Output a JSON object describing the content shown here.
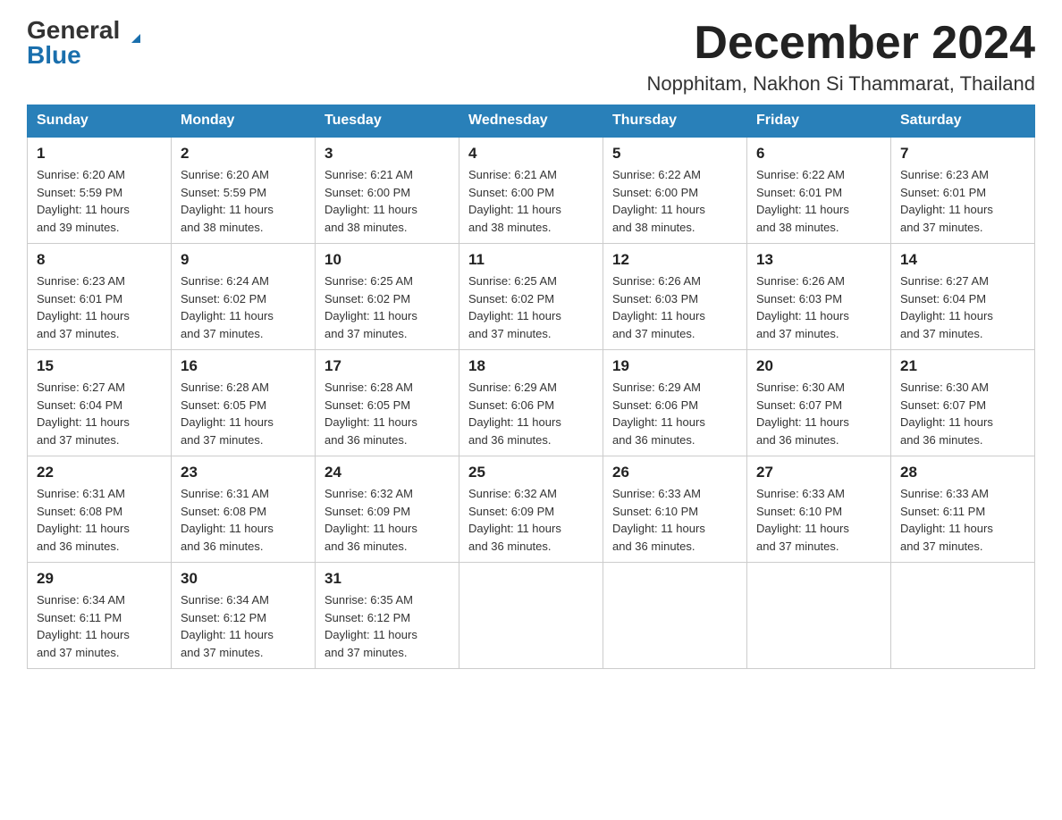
{
  "logo": {
    "general": "General",
    "blue": "Blue",
    "triangle": "▲"
  },
  "title": {
    "month_year": "December 2024",
    "location": "Nopphitam, Nakhon Si Thammarat, Thailand"
  },
  "headers": [
    "Sunday",
    "Monday",
    "Tuesday",
    "Wednesday",
    "Thursday",
    "Friday",
    "Saturday"
  ],
  "weeks": [
    [
      {
        "num": "1",
        "sunrise": "6:20 AM",
        "sunset": "5:59 PM",
        "daylight": "11 hours and 39 minutes."
      },
      {
        "num": "2",
        "sunrise": "6:20 AM",
        "sunset": "5:59 PM",
        "daylight": "11 hours and 38 minutes."
      },
      {
        "num": "3",
        "sunrise": "6:21 AM",
        "sunset": "6:00 PM",
        "daylight": "11 hours and 38 minutes."
      },
      {
        "num": "4",
        "sunrise": "6:21 AM",
        "sunset": "6:00 PM",
        "daylight": "11 hours and 38 minutes."
      },
      {
        "num": "5",
        "sunrise": "6:22 AM",
        "sunset": "6:00 PM",
        "daylight": "11 hours and 38 minutes."
      },
      {
        "num": "6",
        "sunrise": "6:22 AM",
        "sunset": "6:01 PM",
        "daylight": "11 hours and 38 minutes."
      },
      {
        "num": "7",
        "sunrise": "6:23 AM",
        "sunset": "6:01 PM",
        "daylight": "11 hours and 37 minutes."
      }
    ],
    [
      {
        "num": "8",
        "sunrise": "6:23 AM",
        "sunset": "6:01 PM",
        "daylight": "11 hours and 37 minutes."
      },
      {
        "num": "9",
        "sunrise": "6:24 AM",
        "sunset": "6:02 PM",
        "daylight": "11 hours and 37 minutes."
      },
      {
        "num": "10",
        "sunrise": "6:25 AM",
        "sunset": "6:02 PM",
        "daylight": "11 hours and 37 minutes."
      },
      {
        "num": "11",
        "sunrise": "6:25 AM",
        "sunset": "6:02 PM",
        "daylight": "11 hours and 37 minutes."
      },
      {
        "num": "12",
        "sunrise": "6:26 AM",
        "sunset": "6:03 PM",
        "daylight": "11 hours and 37 minutes."
      },
      {
        "num": "13",
        "sunrise": "6:26 AM",
        "sunset": "6:03 PM",
        "daylight": "11 hours and 37 minutes."
      },
      {
        "num": "14",
        "sunrise": "6:27 AM",
        "sunset": "6:04 PM",
        "daylight": "11 hours and 37 minutes."
      }
    ],
    [
      {
        "num": "15",
        "sunrise": "6:27 AM",
        "sunset": "6:04 PM",
        "daylight": "11 hours and 37 minutes."
      },
      {
        "num": "16",
        "sunrise": "6:28 AM",
        "sunset": "6:05 PM",
        "daylight": "11 hours and 37 minutes."
      },
      {
        "num": "17",
        "sunrise": "6:28 AM",
        "sunset": "6:05 PM",
        "daylight": "11 hours and 36 minutes."
      },
      {
        "num": "18",
        "sunrise": "6:29 AM",
        "sunset": "6:06 PM",
        "daylight": "11 hours and 36 minutes."
      },
      {
        "num": "19",
        "sunrise": "6:29 AM",
        "sunset": "6:06 PM",
        "daylight": "11 hours and 36 minutes."
      },
      {
        "num": "20",
        "sunrise": "6:30 AM",
        "sunset": "6:07 PM",
        "daylight": "11 hours and 36 minutes."
      },
      {
        "num": "21",
        "sunrise": "6:30 AM",
        "sunset": "6:07 PM",
        "daylight": "11 hours and 36 minutes."
      }
    ],
    [
      {
        "num": "22",
        "sunrise": "6:31 AM",
        "sunset": "6:08 PM",
        "daylight": "11 hours and 36 minutes."
      },
      {
        "num": "23",
        "sunrise": "6:31 AM",
        "sunset": "6:08 PM",
        "daylight": "11 hours and 36 minutes."
      },
      {
        "num": "24",
        "sunrise": "6:32 AM",
        "sunset": "6:09 PM",
        "daylight": "11 hours and 36 minutes."
      },
      {
        "num": "25",
        "sunrise": "6:32 AM",
        "sunset": "6:09 PM",
        "daylight": "11 hours and 36 minutes."
      },
      {
        "num": "26",
        "sunrise": "6:33 AM",
        "sunset": "6:10 PM",
        "daylight": "11 hours and 36 minutes."
      },
      {
        "num": "27",
        "sunrise": "6:33 AM",
        "sunset": "6:10 PM",
        "daylight": "11 hours and 37 minutes."
      },
      {
        "num": "28",
        "sunrise": "6:33 AM",
        "sunset": "6:11 PM",
        "daylight": "11 hours and 37 minutes."
      }
    ],
    [
      {
        "num": "29",
        "sunrise": "6:34 AM",
        "sunset": "6:11 PM",
        "daylight": "11 hours and 37 minutes."
      },
      {
        "num": "30",
        "sunrise": "6:34 AM",
        "sunset": "6:12 PM",
        "daylight": "11 hours and 37 minutes."
      },
      {
        "num": "31",
        "sunrise": "6:35 AM",
        "sunset": "6:12 PM",
        "daylight": "11 hours and 37 minutes."
      },
      null,
      null,
      null,
      null
    ]
  ],
  "labels": {
    "sunrise": "Sunrise:",
    "sunset": "Sunset:",
    "daylight": "Daylight:"
  }
}
